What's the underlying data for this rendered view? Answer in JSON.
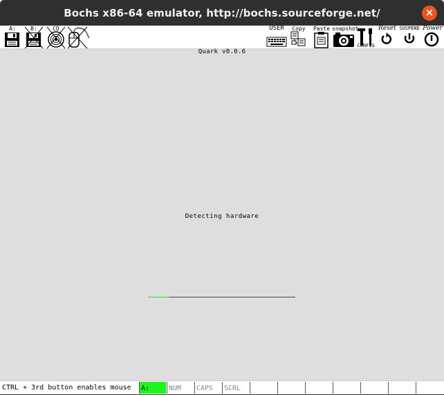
{
  "window": {
    "title": "Bochs x86-64 emulator, http://bochs.sourceforge.net/",
    "close_glyph": "×",
    "accent_color": "#e95420"
  },
  "toolbar": {
    "floppy_a_label": "A:",
    "floppy_b_label": "B:",
    "cdrom_label": "CD",
    "user_label": "USER",
    "copy_label": "Copy",
    "paste_label": "Paste",
    "snapshot_label": "snapshot",
    "config_label": "CONFIG",
    "reset_label": "Reset",
    "suspend_label": "SUSPEND",
    "power_label": "Power"
  },
  "screen": {
    "header_text": "Quark v0.0.6",
    "message_text": "Detecting hardware",
    "progress_fraction": 0.14,
    "progress_color": "#27e027"
  },
  "statusbar": {
    "message": "CTRL + 3rd button enables mouse",
    "indicators": [
      {
        "label": "A:",
        "active": true
      },
      {
        "label": "NUM",
        "active": false
      },
      {
        "label": "CAPS",
        "active": false
      },
      {
        "label": "SCRL",
        "active": false
      },
      {
        "label": "",
        "active": false
      },
      {
        "label": "",
        "active": false
      },
      {
        "label": "",
        "active": false
      },
      {
        "label": "",
        "active": false
      },
      {
        "label": "",
        "active": false
      },
      {
        "label": "",
        "active": false
      }
    ],
    "active_color": "#1ef51e"
  }
}
